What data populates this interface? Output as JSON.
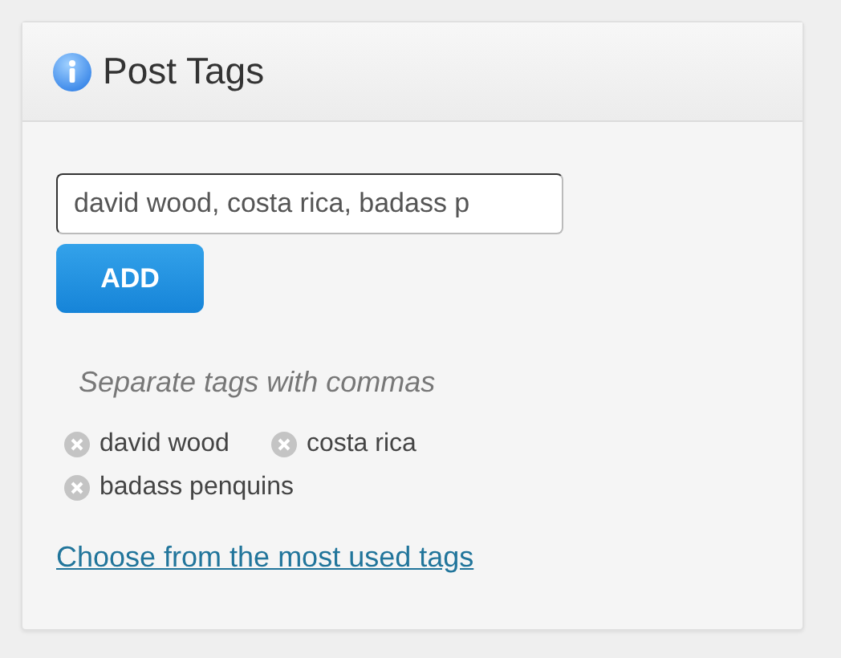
{
  "panel": {
    "title": "Post Tags"
  },
  "tag_input": {
    "value": "david wood, costa rica, badass p"
  },
  "add_button": {
    "label": "ADD"
  },
  "hint": "Separate tags with commas",
  "tags": [
    {
      "label": "david wood"
    },
    {
      "label": "costa rica"
    },
    {
      "label": "badass penquins"
    }
  ],
  "link": "Choose from the most used tags"
}
